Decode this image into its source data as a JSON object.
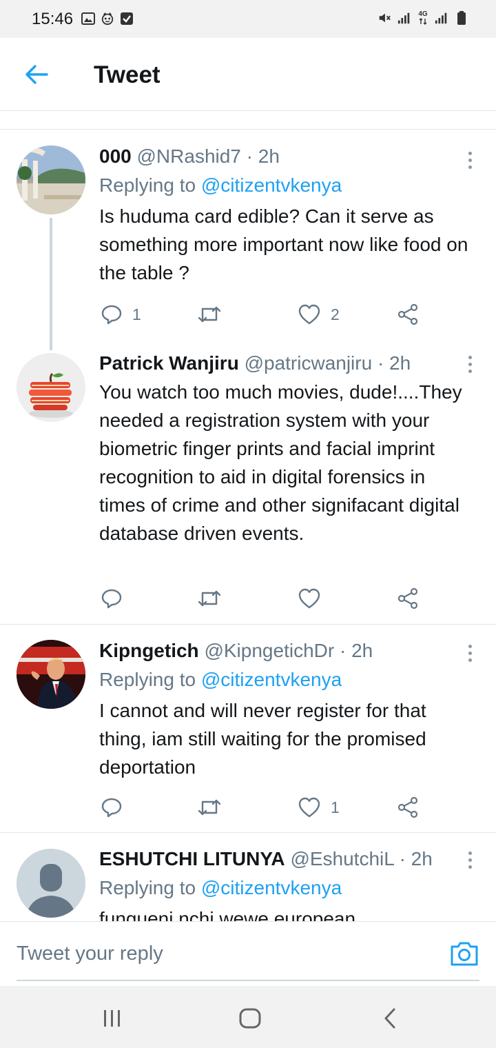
{
  "status_bar": {
    "time": "15:46",
    "left_icons": [
      "image-icon",
      "mascot-icon",
      "check-box-icon"
    ],
    "right_icons": [
      "mute-icon",
      "signal-icon",
      "network-4g-icon",
      "signal-icon",
      "battery-icon"
    ],
    "network_label": "4G"
  },
  "header": {
    "back_icon": "arrow-left-icon",
    "title": "Tweet"
  },
  "colors": {
    "accent": "#1da1f2",
    "secondary_text": "#657786",
    "primary_text": "#14171a",
    "divider": "#e1e6ea"
  },
  "tweets": [
    {
      "name": "000",
      "handle": "@NRashid7 · 2h",
      "replying_prefix": "Replying to ",
      "replying_to": "@citizentvkenya",
      "text": "Is huduma card edible? Can it serve as something more important now like food on the table ?",
      "replies": "1",
      "retweets": "",
      "likes": "2"
    },
    {
      "name": "Patrick Wanjiru",
      "handle": "@patricwanjiru · 2h",
      "text": "You watch too much movies, dude!....They needed a registration system with your biometric finger prints and facial imprint recognition to aid in digital forensics in times of crime and other signifacant digital database driven events.",
      "replies": "",
      "retweets": "",
      "likes": ""
    },
    {
      "name": "Kipngetich",
      "handle": "@KipngetichDr · 2h",
      "replying_prefix": "Replying to ",
      "replying_to": "@citizentvkenya",
      "text": "I cannot and will never register for that thing, iam still waiting for the promised deportation",
      "replies": "",
      "retweets": "",
      "likes": "1"
    },
    {
      "name": "ESHUTCHI LITUNYA",
      "handle": "@EshutchiL · 2h",
      "replying_prefix": "Replying to ",
      "replying_to": "@citizentvkenya",
      "text": "fungueni nchi wewe european"
    }
  ],
  "reply_box": {
    "placeholder": "Tweet your reply",
    "camera_icon": "camera-icon"
  },
  "nav_bar": {
    "icons": [
      "recent-apps-icon",
      "home-icon",
      "back-icon"
    ]
  }
}
